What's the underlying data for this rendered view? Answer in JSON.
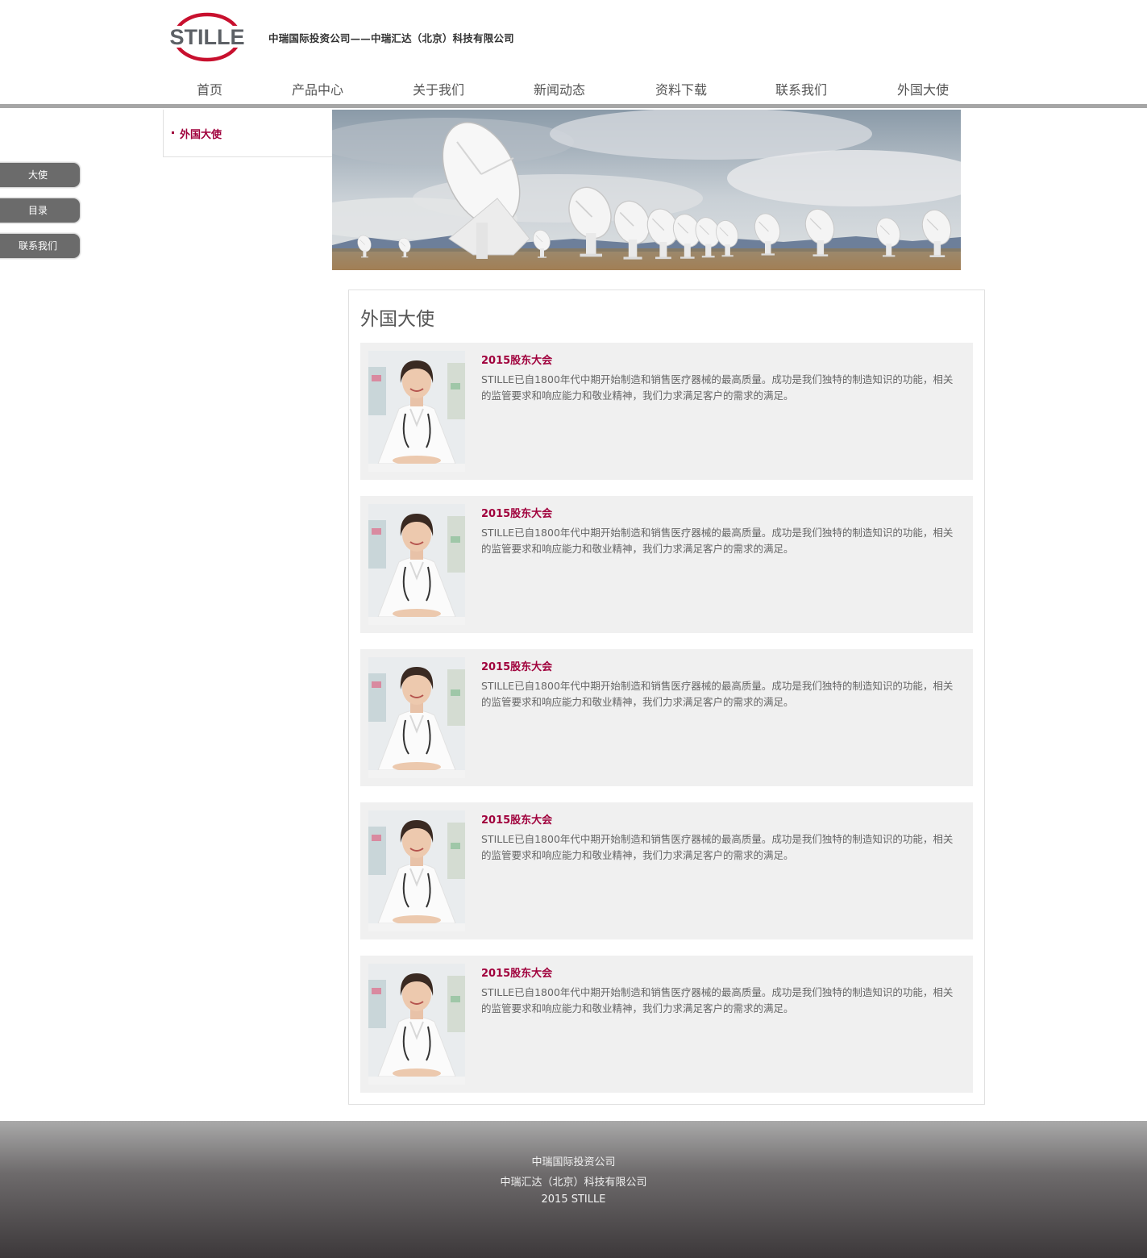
{
  "header": {
    "logo_text": "STILLE",
    "company_title": "中瑞国际投资公司——中瑞汇达（北京）科技有限公司"
  },
  "nav": {
    "items": [
      {
        "label": "首页"
      },
      {
        "label": "产品中心"
      },
      {
        "label": "关于我们"
      },
      {
        "label": "新闻动态"
      },
      {
        "label": "资料下载"
      },
      {
        "label": "联系我们"
      },
      {
        "label": "外国大使"
      }
    ]
  },
  "sidebar": {
    "active_link": "外国大使"
  },
  "float_tabs": [
    {
      "label": "大使"
    },
    {
      "label": "目录"
    },
    {
      "label": "联系我们"
    }
  ],
  "content": {
    "title": "外国大使",
    "cards": [
      {
        "title": "2015股东大会",
        "text": "STILLE已自1800年代中期开始制造和销售医疗器械的最高质量。成功是我们独特的制造知识的功能，相关的监管要求和响应能力和敬业精神，我们力求满足客户的需求的满足。"
      },
      {
        "title": "2015股东大会",
        "text": "STILLE已自1800年代中期开始制造和销售医疗器械的最高质量。成功是我们独特的制造知识的功能，相关的监管要求和响应能力和敬业精神，我们力求满足客户的需求的满足。"
      },
      {
        "title": "2015股东大会",
        "text": "STILLE已自1800年代中期开始制造和销售医疗器械的最高质量。成功是我们独特的制造知识的功能，相关的监管要求和响应能力和敬业精神，我们力求满足客户的需求的满足。"
      },
      {
        "title": "2015股东大会",
        "text": "STILLE已自1800年代中期开始制造和销售医疗器械的最高质量。成功是我们独特的制造知识的功能，相关的监管要求和响应能力和敬业精神，我们力求满足客户的需求的满足。"
      },
      {
        "title": "2015股东大会",
        "text": "STILLE已自1800年代中期开始制造和销售医疗器械的最高质量。成功是我们独特的制造知识的功能，相关的监管要求和响应能力和敬业精神，我们力求满足客户的需求的满足。"
      }
    ]
  },
  "footer": {
    "line1": "中瑞国际投资公司",
    "line2": "中瑞汇达（北京）科技有限公司",
    "line3": "2015 STILLE"
  },
  "colors": {
    "accent": "#a0003c",
    "nav_bar": "#a6a6a6",
    "card_bg": "#f0f0f0",
    "tab_bg": "#6b6b6b"
  }
}
